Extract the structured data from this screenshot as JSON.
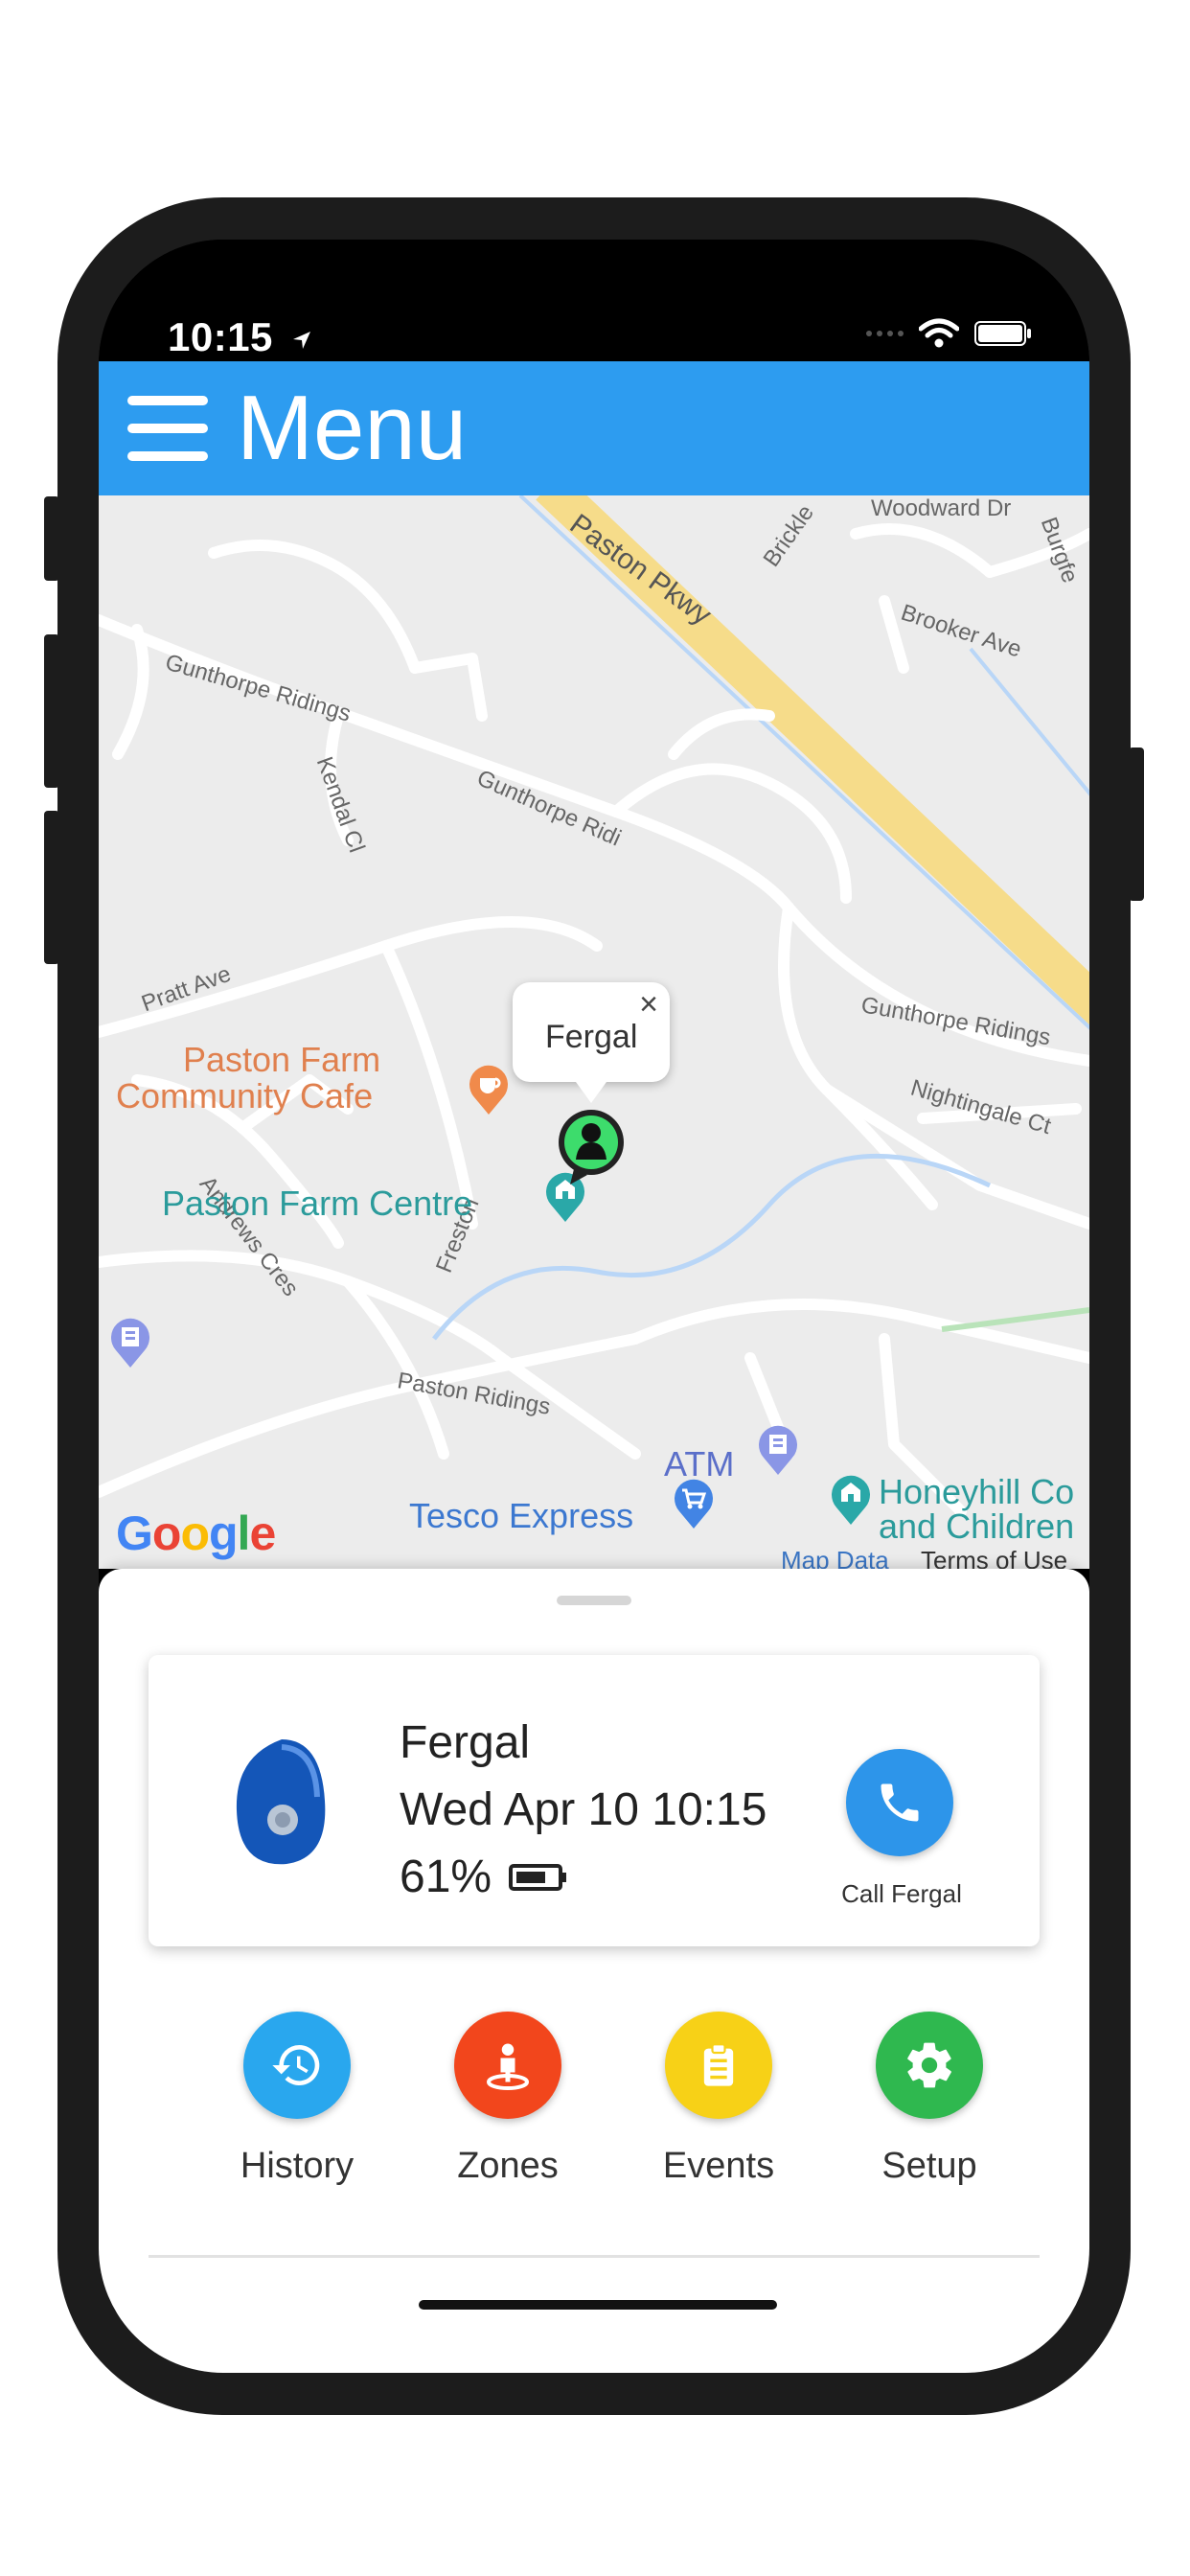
{
  "status_bar": {
    "time": "10:15"
  },
  "appbar": {
    "title": "Menu"
  },
  "map": {
    "streets": [
      "Paston Pkwy",
      "Woodward Dr",
      "Brickle",
      "Burgfe",
      "Brooker Ave",
      "Gunthorpe Ridings",
      "Kendal Cl",
      "Gunthorpe Ridi",
      "Pratt Ave",
      "Gunthorpe Ridings",
      "Nightingale Ct",
      "Andrews Cres",
      "Freston",
      "Paston Ridings"
    ],
    "pois": {
      "cafe_line1": "Paston Farm",
      "cafe_line2": "Community Cafe",
      "centre": "Paston Farm Centre",
      "atm": "ATM",
      "tesco": "Tesco Express",
      "honeyhill_line1": "Honeyhill Co",
      "honeyhill_line2": "and Children"
    },
    "callout_name": "Fergal",
    "google": "Google",
    "map_data": "Map Data",
    "terms": "Terms of Use"
  },
  "device_card": {
    "name": "Fergal",
    "datetime": "Wed Apr 10 10:15",
    "battery": "61%",
    "call_label": "Call Fergal"
  },
  "actions": [
    {
      "label": "History",
      "color": "#29a7ee",
      "icon": "history-icon"
    },
    {
      "label": "Zones",
      "color": "#f2461c",
      "icon": "zones-icon"
    },
    {
      "label": "Events",
      "color": "#f7d117",
      "icon": "events-icon"
    },
    {
      "label": "Setup",
      "color": "#2fb84f",
      "icon": "gear-icon"
    }
  ],
  "colors": {
    "accent": "#2d9cf0",
    "marker": "#3ddc6c"
  }
}
